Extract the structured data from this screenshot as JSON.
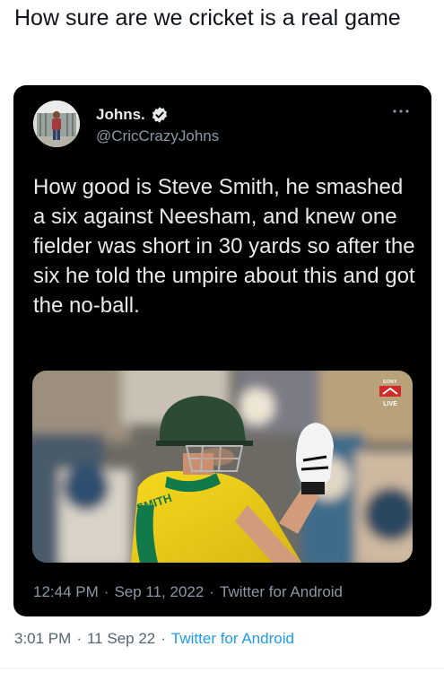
{
  "post": {
    "text": "How sure are we cricket is a real game",
    "footer": {
      "time": "3:01 PM",
      "date": "11 Sep 22",
      "source": "Twitter for Android",
      "sep": "·"
    }
  },
  "tweet_card": {
    "author_name": "Johns.",
    "handle": "@CricCrazyJohns",
    "verified_icon": "verified-badge-icon",
    "more_icon": "more-options-icon",
    "text": "How good is Steve Smith, he smashed a six against Neesham, and knew one fielder was short in 30 yards so after the six he told the umpire about this and got the no-ball.",
    "media": {
      "broadcaster_logo": "SONY",
      "broadcaster_sub": "TEN",
      "live_label": "LIVE",
      "jersey_text": "SMITH"
    },
    "timestamp": {
      "time": "12:44 PM",
      "date": "Sep 11, 2022",
      "source": "Twitter for Android",
      "sep": "·"
    }
  },
  "colors": {
    "card_bg": "#000000",
    "card_text": "#e7e9ea",
    "card_meta": "#8b98a5",
    "link": "#1d9bf0",
    "jersey_yellow": "#f2d21b",
    "jersey_green": "#127a4a"
  }
}
